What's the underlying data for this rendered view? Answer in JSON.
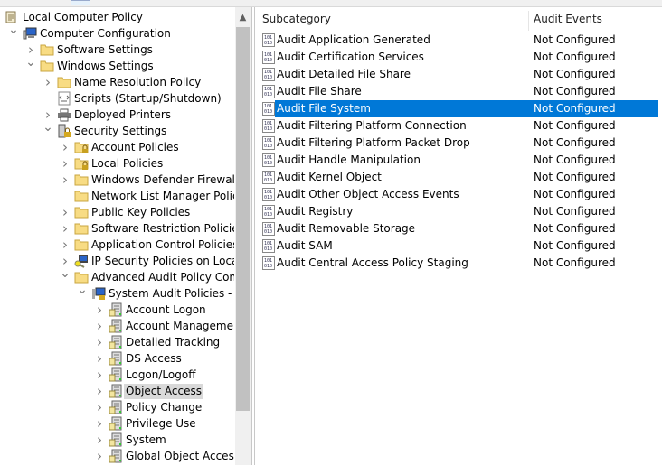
{
  "colors": {
    "selection": "#0078d7",
    "tree_selection": "#d9d9d9"
  },
  "tree": [
    {
      "label": "Local Computer Policy",
      "level": 0,
      "chevron": "none",
      "icon": "policy-scroll-icon"
    },
    {
      "label": "Computer Configuration",
      "level": 1,
      "chevron": "expanded",
      "icon": "computer-icon"
    },
    {
      "label": "Software Settings",
      "level": 2,
      "chevron": "collapsed",
      "icon": "folder-icon"
    },
    {
      "label": "Windows Settings",
      "level": 2,
      "chevron": "expanded",
      "icon": "folder-icon"
    },
    {
      "label": "Name Resolution Policy",
      "level": 3,
      "chevron": "collapsed",
      "icon": "folder-icon"
    },
    {
      "label": "Scripts (Startup/Shutdown)",
      "level": 3,
      "chevron": "none",
      "icon": "script-icon"
    },
    {
      "label": "Deployed Printers",
      "level": 3,
      "chevron": "collapsed",
      "icon": "printer-icon"
    },
    {
      "label": "Security Settings",
      "level": 3,
      "chevron": "expanded",
      "icon": "security-settings-icon"
    },
    {
      "label": "Account Policies",
      "level": 4,
      "chevron": "collapsed",
      "icon": "locked-folder-icon"
    },
    {
      "label": "Local Policies",
      "level": 4,
      "chevron": "collapsed",
      "icon": "locked-folder-icon"
    },
    {
      "label": "Windows Defender Firewall wi",
      "level": 4,
      "chevron": "collapsed",
      "icon": "folder-icon"
    },
    {
      "label": "Network List Manager Policies",
      "level": 4,
      "chevron": "none",
      "icon": "folder-icon"
    },
    {
      "label": "Public Key Policies",
      "level": 4,
      "chevron": "collapsed",
      "icon": "folder-icon"
    },
    {
      "label": "Software Restriction Policies",
      "level": 4,
      "chevron": "collapsed",
      "icon": "folder-icon"
    },
    {
      "label": "Application Control Policies",
      "level": 4,
      "chevron": "collapsed",
      "icon": "folder-icon"
    },
    {
      "label": "IP Security Policies on Local C",
      "level": 4,
      "chevron": "collapsed",
      "icon": "ip-security-icon"
    },
    {
      "label": "Advanced Audit Policy Config",
      "level": 4,
      "chevron": "expanded",
      "icon": "folder-icon"
    },
    {
      "label": "System Audit Policies - Lo",
      "level": 5,
      "chevron": "expanded",
      "icon": "audit-policies-icon"
    },
    {
      "label": "Account Logon",
      "level": 6,
      "chevron": "collapsed",
      "icon": "audit-category-icon"
    },
    {
      "label": "Account Management",
      "level": 6,
      "chevron": "collapsed",
      "icon": "audit-category-icon"
    },
    {
      "label": "Detailed Tracking",
      "level": 6,
      "chevron": "collapsed",
      "icon": "audit-category-icon"
    },
    {
      "label": "DS Access",
      "level": 6,
      "chevron": "collapsed",
      "icon": "audit-category-icon"
    },
    {
      "label": "Logon/Logoff",
      "level": 6,
      "chevron": "collapsed",
      "icon": "audit-category-icon"
    },
    {
      "label": "Object Access",
      "level": 6,
      "chevron": "collapsed",
      "icon": "audit-category-icon",
      "selected": true
    },
    {
      "label": "Policy Change",
      "level": 6,
      "chevron": "collapsed",
      "icon": "audit-category-icon"
    },
    {
      "label": "Privilege Use",
      "level": 6,
      "chevron": "collapsed",
      "icon": "audit-category-icon"
    },
    {
      "label": "System",
      "level": 6,
      "chevron": "collapsed",
      "icon": "audit-category-icon"
    },
    {
      "label": "Global Object Access A",
      "level": 6,
      "chevron": "collapsed",
      "icon": "audit-category-icon"
    }
  ],
  "list": {
    "columns": [
      "Subcategory",
      "Audit Events"
    ],
    "rows": [
      {
        "subcategory": "Audit Application Generated",
        "events": "Not Configured"
      },
      {
        "subcategory": "Audit Certification Services",
        "events": "Not Configured"
      },
      {
        "subcategory": "Audit Detailed File Share",
        "events": "Not Configured"
      },
      {
        "subcategory": "Audit File Share",
        "events": "Not Configured"
      },
      {
        "subcategory": "Audit File System",
        "events": "Not Configured",
        "selected": true
      },
      {
        "subcategory": "Audit Filtering Platform Connection",
        "events": "Not Configured"
      },
      {
        "subcategory": "Audit Filtering Platform Packet Drop",
        "events": "Not Configured"
      },
      {
        "subcategory": "Audit Handle Manipulation",
        "events": "Not Configured"
      },
      {
        "subcategory": "Audit Kernel Object",
        "events": "Not Configured"
      },
      {
        "subcategory": "Audit Other Object Access Events",
        "events": "Not Configured"
      },
      {
        "subcategory": "Audit Registry",
        "events": "Not Configured"
      },
      {
        "subcategory": "Audit Removable Storage",
        "events": "Not Configured"
      },
      {
        "subcategory": "Audit SAM",
        "events": "Not Configured"
      },
      {
        "subcategory": "Audit Central Access Policy Staging",
        "events": "Not Configured"
      }
    ]
  }
}
